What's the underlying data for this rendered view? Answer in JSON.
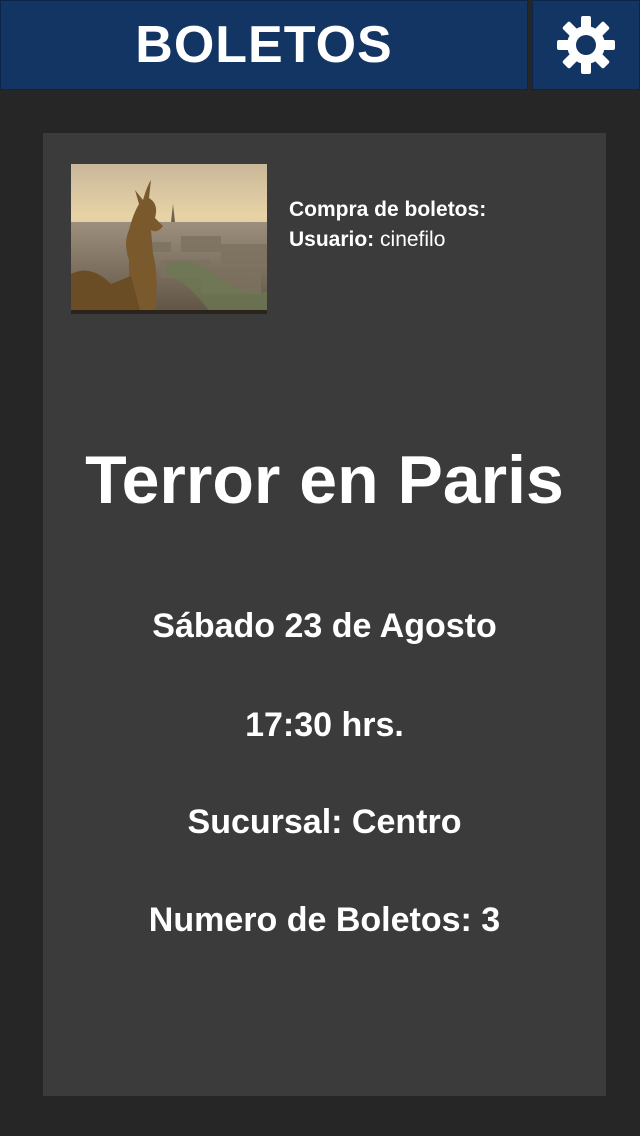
{
  "header": {
    "title": "BOLETOS",
    "settings_icon": "gear-icon",
    "colors": {
      "header_bg": "#133564",
      "app_bg": "#262626",
      "card_bg": "#3b3b3b"
    }
  },
  "purchase": {
    "heading": "Compra de boletos:",
    "user_label": "Usuario:",
    "user_value": "cinefilo"
  },
  "movie": {
    "title": "Terror en Paris",
    "date": "Sábado 23 de Agosto",
    "time": "17:30 hrs.",
    "branch": "Sucursal: Centro",
    "tickets": "Numero de Boletos: 3"
  }
}
